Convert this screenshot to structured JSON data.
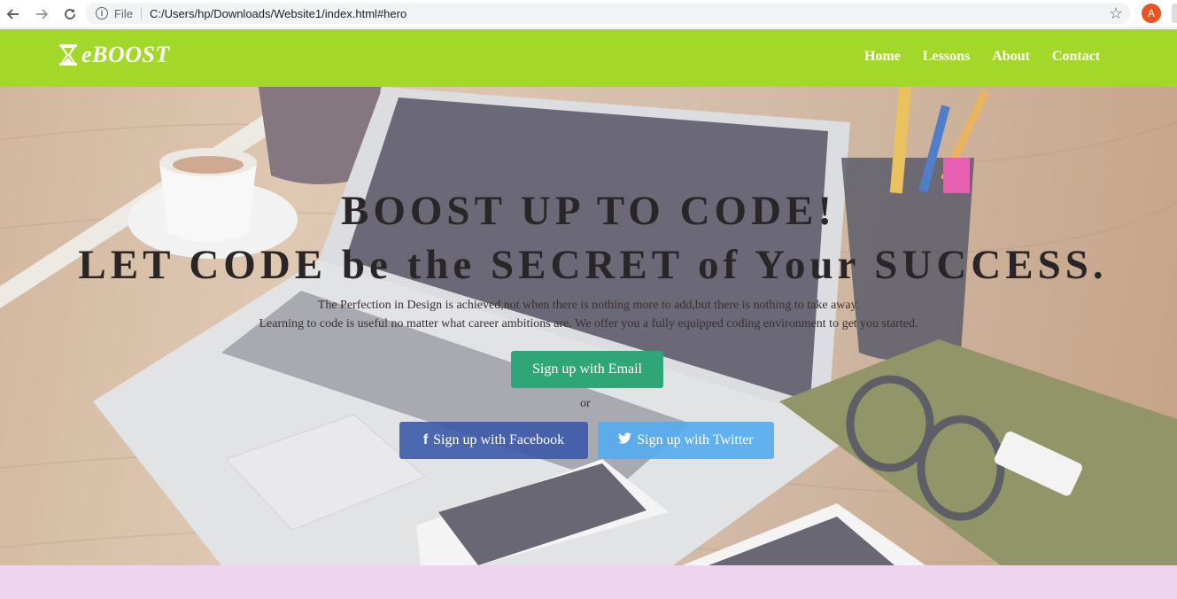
{
  "browser": {
    "file_label": "File",
    "url": "C:/Users/hp/Downloads/Website1/index.html#hero",
    "avatar_initial": "A",
    "icons": [
      "back-arrow-icon",
      "forward-arrow-icon",
      "reload-icon",
      "info-icon",
      "star-icon"
    ]
  },
  "header": {
    "logo_text": "eBOOST",
    "logo_icon": "hourglass-icon",
    "nav": [
      "Home",
      "Lessons",
      "About",
      "Contact"
    ],
    "background": "#a3d72a"
  },
  "hero": {
    "title_line1": "BOOST UP TO CODE!",
    "title_line2": "LET CODE be the SECRET of Your SUCCESS.",
    "tagline1": "The Perfection in Design is achieved,not when there is nothing more to add,but there is nothing to take away.",
    "tagline2": "Learning to code is useful no matter what career ambitions are. We offer you a fully equipped coding environment to get you started.",
    "email_button": "Sign up with Email",
    "or_text": "or",
    "facebook_button": "Sign up with Facebook",
    "twitter_button": "Sign up with Twitter",
    "colors": {
      "email": "#2fa677",
      "facebook": "#3b59aa",
      "twitter": "#55acee"
    }
  },
  "next_section": {
    "background": "#f0d4ef"
  }
}
